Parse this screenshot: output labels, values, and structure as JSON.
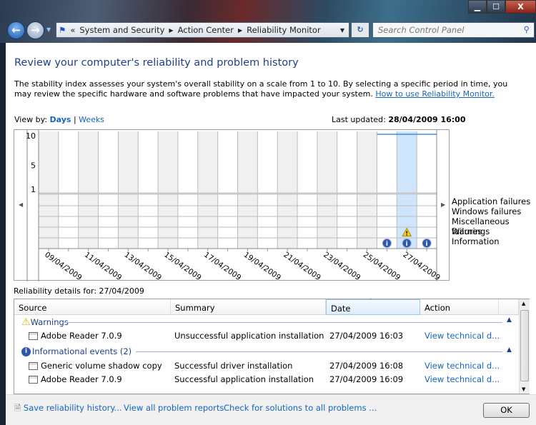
{
  "window": {
    "minimize": "▁",
    "maximize": "☐",
    "close": "X"
  },
  "address": {
    "overflow": "«",
    "crumbs": [
      "System and Security",
      "Action Center",
      "Reliability Monitor"
    ],
    "search_placeholder": "Search Control Panel"
  },
  "page": {
    "title": "Review your computer's reliability and problem history",
    "description": "The stability index assesses your system's overall stability on a scale from 1 to 10. By selecting a specific period in time, you may review the specific hardware and software problems that have impacted your system.",
    "help_link": "How to use Reliability Monitor.",
    "view_by_label": "View by:",
    "view_days": "Days",
    "view_sep": "|",
    "view_weeks": "Weeks",
    "last_updated_label": "Last updated:",
    "last_updated_value": "28/04/2009 16:00"
  },
  "chart_data": {
    "type": "line",
    "y_ticks": [
      "10",
      "5",
      "1"
    ],
    "ylim": [
      1,
      10
    ],
    "days": [
      "09/04/2009",
      "10/04/2009",
      "11/04/2009",
      "12/04/2009",
      "13/04/2009",
      "14/04/2009",
      "15/04/2009",
      "16/04/2009",
      "17/04/2009",
      "18/04/2009",
      "19/04/2009",
      "20/04/2009",
      "21/04/2009",
      "22/04/2009",
      "23/04/2009",
      "24/04/2009",
      "25/04/2009",
      "26/04/2009",
      "27/04/2009",
      "28/04/2009"
    ],
    "x_tick_labels": [
      "09/04/2009",
      "11/04/2009",
      "13/04/2009",
      "15/04/2009",
      "17/04/2009",
      "19/04/2009",
      "21/04/2009",
      "23/04/2009",
      "25/04/2009",
      "27/04/2009"
    ],
    "stability_index": {
      "26/04/2009": 10,
      "27/04/2009": 10,
      "28/04/2009": 10
    },
    "selected_day": "27/04/2009",
    "line_color": "#3c8ee8",
    "selected_color": "#cfe5fb",
    "rows": [
      "Application failures",
      "Windows failures",
      "Miscellaneous failures",
      "Warnings",
      "Information"
    ],
    "events": [
      {
        "day": "27/04/2009",
        "row": "Warnings",
        "icon": "warning-icon"
      },
      {
        "day": "26/04/2009",
        "row": "Information",
        "icon": "info-icon"
      },
      {
        "day": "27/04/2009",
        "row": "Information",
        "icon": "info-icon"
      },
      {
        "day": "28/04/2009",
        "row": "Information",
        "icon": "info-icon"
      }
    ]
  },
  "details": {
    "label": "Reliability details for: 27/04/2009",
    "columns": [
      "Source",
      "Summary",
      "Date",
      "Action"
    ],
    "groups": [
      {
        "title": "Warnings",
        "icon": "warning-icon",
        "rows": [
          {
            "source": "Adobe Reader 7.0.9",
            "summary": "Unsuccessful application installation",
            "date": "27/04/2009 16:03",
            "action": "View  technical d..."
          }
        ]
      },
      {
        "title": "Informational events (2)",
        "icon": "info-icon",
        "rows": [
          {
            "source": "Generic volume shadow copy",
            "summary": "Successful driver installation",
            "date": "27/04/2009 16:08",
            "action": "View  technical d..."
          },
          {
            "source": "Adobe Reader 7.0.9",
            "summary": "Successful application installation",
            "date": "27/04/2009 16:09",
            "action": "View  technical d..."
          }
        ]
      }
    ]
  },
  "footer": {
    "save": "Save reliability history...",
    "view_all": "View all problem reports",
    "check": "Check for solutions to all problems ...",
    "ok": "OK"
  }
}
